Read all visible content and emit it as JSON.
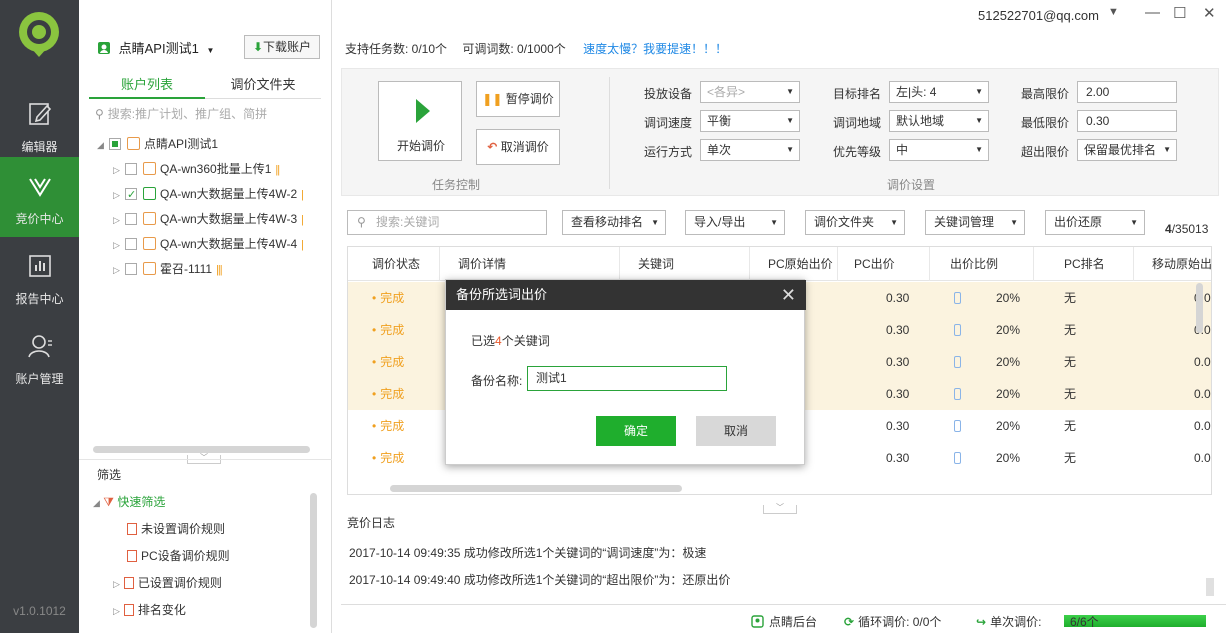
{
  "nav": {
    "items": [
      {
        "label": "编辑器",
        "icon": "edit-icon"
      },
      {
        "label": "竞价中心",
        "icon": "bid-center-icon"
      },
      {
        "label": "报告中心",
        "icon": "chart-icon"
      },
      {
        "label": "账户管理",
        "icon": "user-icon"
      }
    ],
    "version": "v1.0.1012"
  },
  "left": {
    "account_name": "点睛API测试1",
    "download_button": "下载账户",
    "tabs": [
      "账户列表",
      "调价文件夹"
    ],
    "search_placeholder": "搜索:推广计划、推广组、简拼",
    "tree_root": "点睛API测试1",
    "tree_items": [
      {
        "label": "QA-wn360批量上传1",
        "checked": false
      },
      {
        "label": "QA-wn大数据量上传4W-2",
        "checked": true
      },
      {
        "label": "QA-wn大数据量上传4W-3",
        "checked": false
      },
      {
        "label": "QA-wn大数据量上传4W-4",
        "checked": false
      },
      {
        "label": "霍召-1111",
        "checked": false
      }
    ],
    "filter_title": "筛选",
    "quick_filter": "快速筛选",
    "filter_items": [
      "未设置调价规则",
      "PC设备调价规则",
      "已设置调价规则",
      "排名变化"
    ]
  },
  "header": {
    "email": "512522701@qq.com"
  },
  "info": {
    "tasks": "支持任务数: 0/10个",
    "adjustable": "可调词数: 0/1000个",
    "speed_link": "速度太慢？我要提速！！！"
  },
  "task": {
    "start": "开始调价",
    "pause": "暂停调价",
    "cancel": "取消调价",
    "title": "任务控制"
  },
  "settings": {
    "title": "调价设置",
    "device_label": "投放设备",
    "device_value": "<各异>",
    "speed_label": "调词速度",
    "speed_value": "平衡",
    "mode_label": "运行方式",
    "mode_value": "单次",
    "rank_label": "目标排名",
    "rank_value": "左|头: 4",
    "region_label": "调词地域",
    "region_value": "默认地域",
    "priority_label": "优先等级",
    "priority_value": "中",
    "max_label": "最高限价",
    "max_value": "2.00",
    "min_label": "最低限价",
    "min_value": "0.30",
    "over_label": "超出限价",
    "over_value": "保留最优排名"
  },
  "toolbar": {
    "search_placeholder": "搜索:关键词",
    "buttons": [
      "查看移动排名",
      "导入/导出",
      "调价文件夹",
      "关键词管理",
      "出价还原"
    ],
    "count_bold": "4",
    "count_total": "/35013"
  },
  "table": {
    "headers": [
      "调价状态",
      "调价详情",
      "关键词",
      "PC原始出价",
      "PC出价",
      "出价比例",
      "PC排名",
      "移动原始出价"
    ],
    "rows": [
      {
        "status": "完成",
        "pc_orig": "0",
        "pc_bid": "0.30",
        "ratio": "20%",
        "rank": "无",
        "mobile_orig": "0.0",
        "selected": true
      },
      {
        "status": "完成",
        "pc_orig": "0",
        "pc_bid": "0.30",
        "ratio": "20%",
        "rank": "无",
        "mobile_orig": "0.0",
        "selected": true
      },
      {
        "status": "完成",
        "pc_orig": "0",
        "pc_bid": "0.30",
        "ratio": "20%",
        "rank": "无",
        "mobile_orig": "0.0",
        "selected": true
      },
      {
        "status": "完成",
        "pc_orig": "0",
        "pc_bid": "0.30",
        "ratio": "20%",
        "rank": "无",
        "mobile_orig": "0.0",
        "selected": true
      },
      {
        "status": "完成",
        "pc_orig": "0",
        "pc_bid": "0.30",
        "ratio": "20%",
        "rank": "无",
        "mobile_orig": "0.0",
        "selected": false
      },
      {
        "status": "完成",
        "pc_orig": "0",
        "pc_bid": "0.30",
        "ratio": "20%",
        "rank": "无",
        "mobile_orig": "0.0",
        "selected": false
      }
    ]
  },
  "log": {
    "title": "竞价日志",
    "entries": [
      "2017-10-14 09:49:35 成功修改所选1个关键词的“调词速度”为：极速",
      "2017-10-14 09:49:40 成功修改所选1个关键词的“超出限价”为：还原出价"
    ]
  },
  "status": {
    "backend": "点睛后台",
    "loop": "循环调价: 0/0个",
    "single": "单次调价:",
    "progress_text": "6/6个",
    "progress_fraction": 1.0
  },
  "dialog": {
    "title": "备份所选词出价",
    "selected_prefix": "已选",
    "selected_count": "4",
    "selected_suffix": "个关键词",
    "name_label": "备份名称:",
    "name_value": "测试1",
    "ok": "确定",
    "cancel": "取消"
  },
  "colors": {
    "accent": "#2aa33a",
    "nav_bg": "#3b3e42",
    "warning": "#f0a020"
  }
}
